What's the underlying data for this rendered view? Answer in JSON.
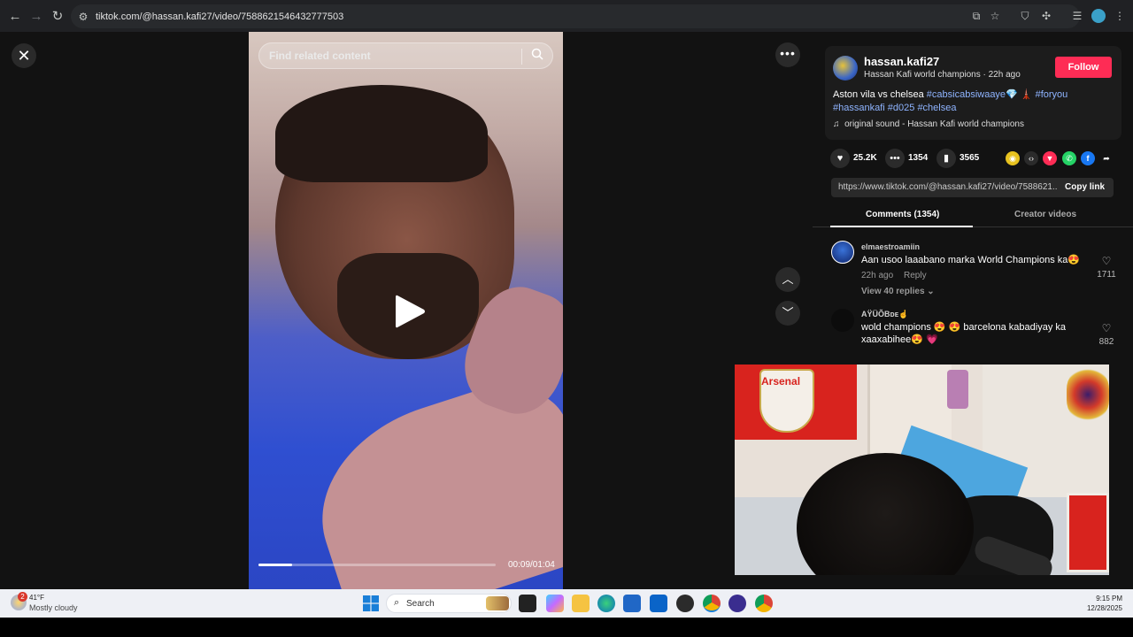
{
  "browser": {
    "url": "tiktok.com/@hassan.kafi27/video/7588621546432777503"
  },
  "video": {
    "search_placeholder": "Find related content",
    "time": "00:09/01:04",
    "progress_fraction": 0.14
  },
  "post": {
    "username": "hassan.kafi27",
    "subline": "Hassan Kafi world champions · 22h ago",
    "follow_label": "Follow",
    "caption_text": "Aston vila vs chelsea ",
    "hashtag_1": "#cabsicabsiwaaye",
    "hashtag_emoji": "💎 🗼",
    "hashtag_2": "#foryou",
    "hashtag_3": "#hassankafi",
    "hashtag_4": "#d025",
    "hashtag_5": "#chelsea",
    "sound": "original sound - Hassan Kafi world champions",
    "likes": "25.2K",
    "comments": "1354",
    "saves": "3565",
    "link": "https://www.tiktok.com/@hassan.kafi27/video/7588621...",
    "copy_link_label": "Copy link"
  },
  "tabs": {
    "comments": "Comments (1354)",
    "creator_videos": "Creator videos"
  },
  "comments": [
    {
      "user": "elmaestroamiin",
      "text": "Aan usoo laaabano marka World Champions ka😍",
      "time": "22h ago",
      "reply": "Reply",
      "view_replies": "View 40 replies ⌄",
      "likes": "1711"
    },
    {
      "user": "AŸÜÕBᴅᴇ☝",
      "text_line1": "wold champions 😍 😍 barcelona kabadiyay ka",
      "text_line2": "xaaxabihee😍 💗",
      "likes": "882"
    }
  ],
  "overlay": {
    "crest_text": "Arsenal"
  },
  "taskbar": {
    "temp": "41°F",
    "condition": "Mostly cloudy",
    "weather_badge": "2",
    "search_label": "Search",
    "time": "9:15 PM",
    "date": "12/28/2025"
  },
  "colors": {
    "follow": "#fe2c55",
    "hashtag": "#8fb4ff",
    "page_bg": "#121212"
  }
}
